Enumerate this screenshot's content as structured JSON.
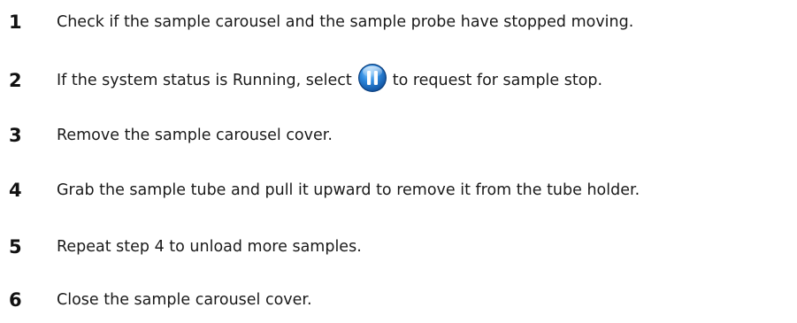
{
  "steps": [
    {
      "number": "1",
      "text": "Check if the sample carousel and the sample probe have stopped moving."
    },
    {
      "number": "2",
      "text_before": "If the system status is Running, select",
      "icon": "pause-icon",
      "text_after": "to request for sample stop."
    },
    {
      "number": "3",
      "text": "Remove the sample carousel cover."
    },
    {
      "number": "4",
      "text": "Grab the sample tube and pull it upward to remove it from the tube holder."
    },
    {
      "number": "5",
      "text": "Repeat step 4 to unload more samples."
    },
    {
      "number": "6",
      "text": "Close the sample carousel cover."
    }
  ],
  "colors": {
    "icon_blue": "#1e6fc4",
    "icon_light": "#7fc0f2",
    "text": "#1a1a1a"
  }
}
